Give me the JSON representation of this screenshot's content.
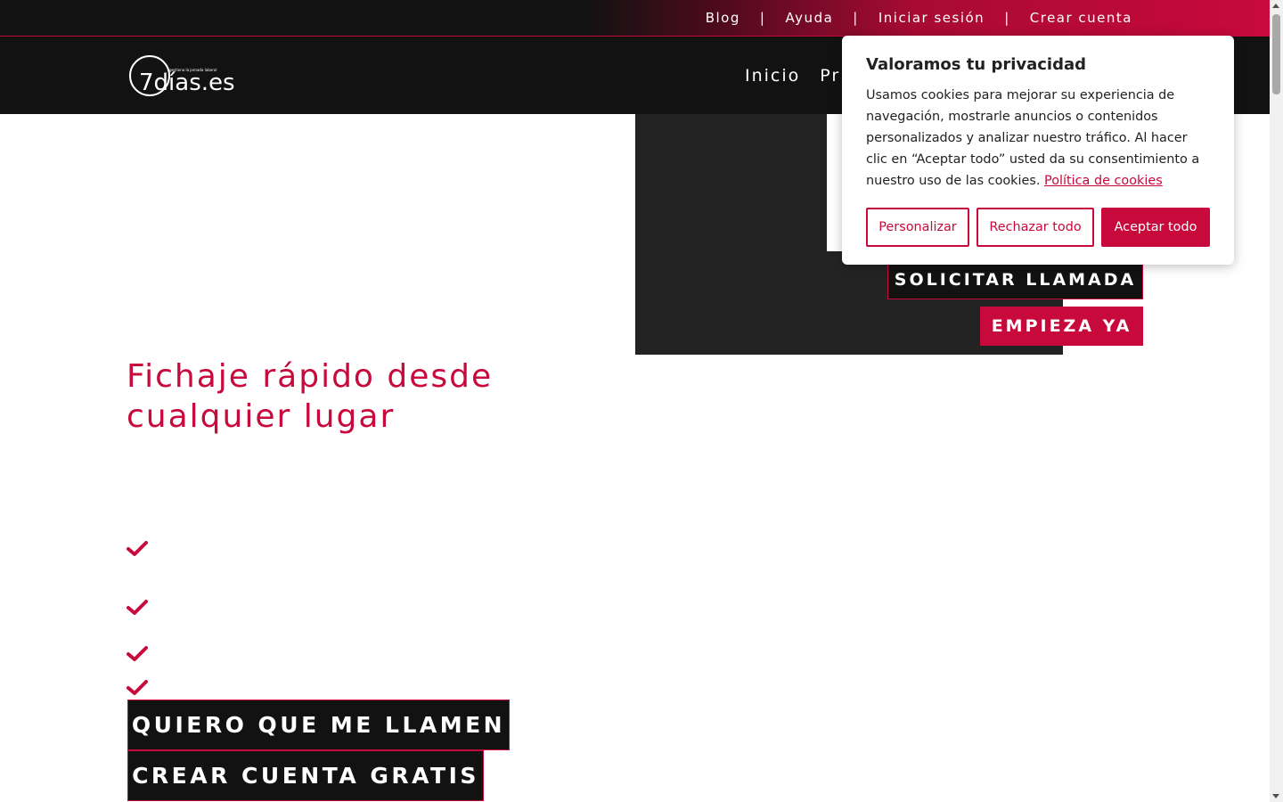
{
  "colors": {
    "brand": "#c8093c",
    "dark": "#121212",
    "panel": "#232323"
  },
  "topbar": {
    "links": [
      "Blog",
      "Ayuda",
      "Iniciar sesión",
      "Crear cuenta"
    ],
    "separator": "|"
  },
  "header": {
    "logo_text": "7días.es",
    "logo_tagline": "gestiona la jornada laboral",
    "nav": [
      "Inicio",
      "Pr"
    ]
  },
  "hero": {
    "call_button": "SOLICITAR LLAMADA",
    "start_button": "EMPIEZA YA",
    "title": "Fichaje rápido desde cualquier lugar",
    "check_icon": "check-icon"
  },
  "cta": {
    "call_me": "QUIERO QUE ME LLAMEN",
    "create_account": "CREAR CUENTA GRATIS"
  },
  "cookie": {
    "title": "Valoramos tu privacidad",
    "text": "Usamos cookies para mejorar su experiencia de navegación, mostrarle anuncios o contenidos personalizados y analizar nuestro tráfico. Al hacer clic en “Aceptar todo” usted da su consentimiento a nuestro uso de las cookies.",
    "policy_link": "Política de cookies",
    "buttons": {
      "customize": "Personalizar",
      "reject": "Rechazar todo",
      "accept": "Aceptar todo"
    }
  }
}
